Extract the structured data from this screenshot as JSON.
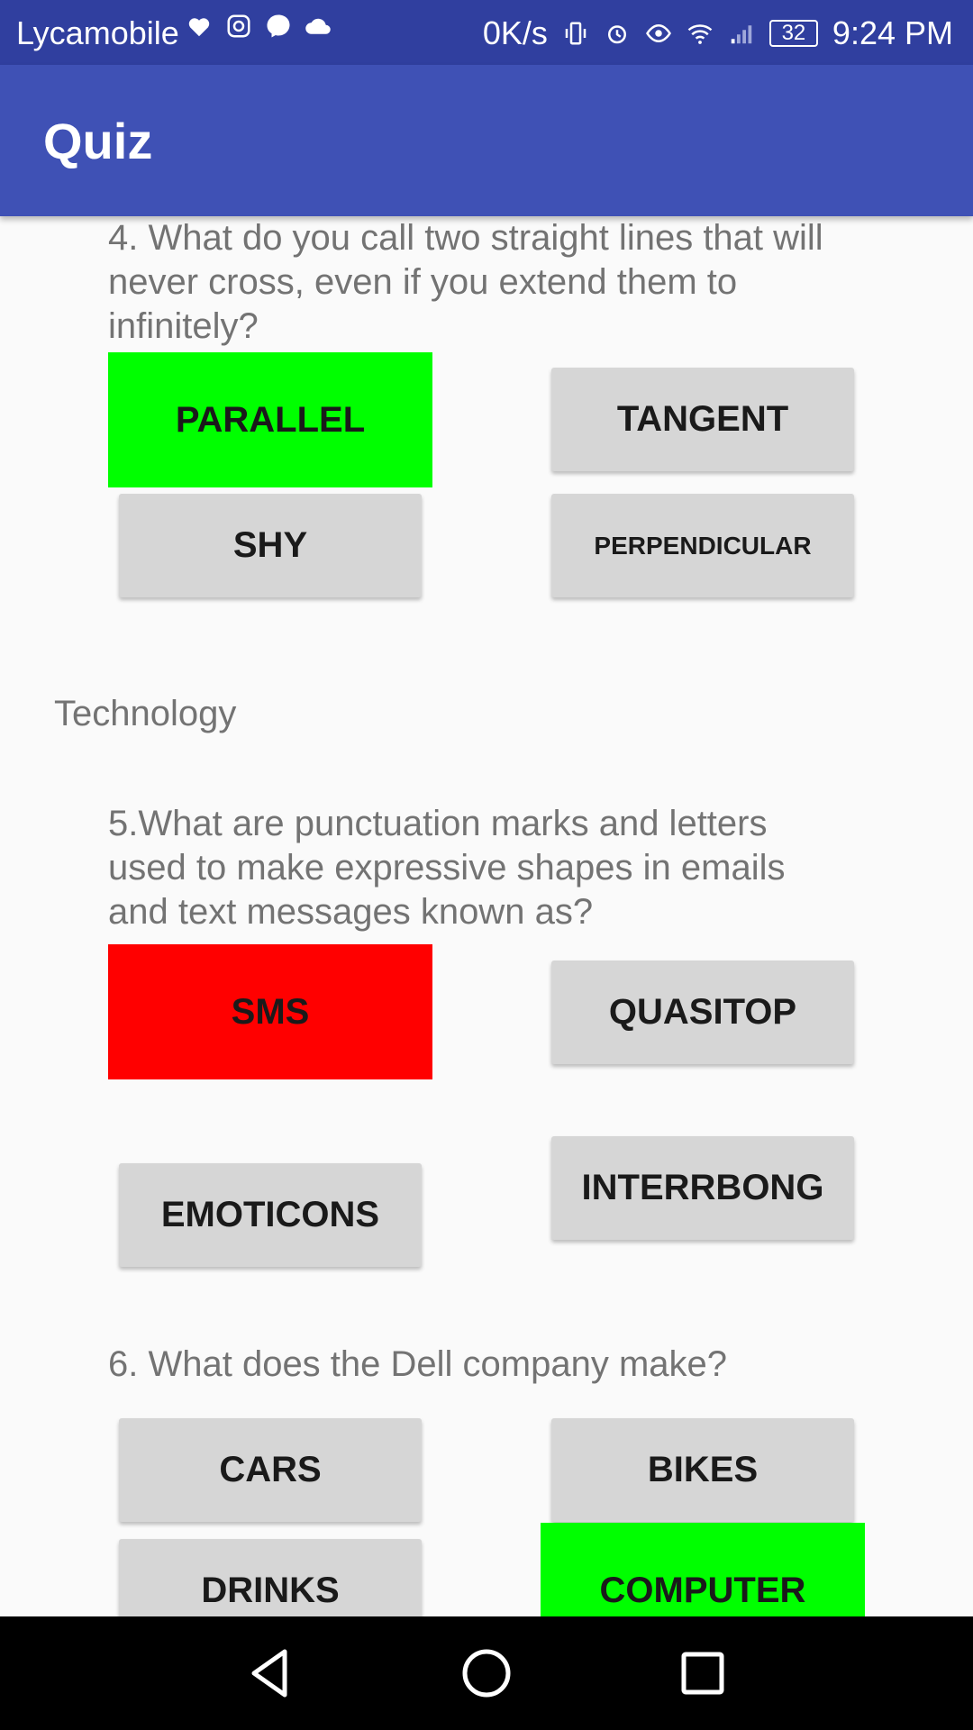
{
  "status_bar": {
    "carrier": "Lycamobile",
    "net_speed": "0K/s",
    "battery": "32",
    "time": "9:24 PM"
  },
  "app_bar": {
    "title": "Quiz"
  },
  "questions": {
    "q4": {
      "text": "4. What do you call two straight lines that will never cross, even if you extend them to infinitely?",
      "options": [
        "PARALLEL",
        "TANGENT",
        "SHY",
        "PERPENDICULAR"
      ]
    },
    "section_technology": "Technology",
    "q5": {
      "text": "5.What are punctuation marks and letters used to make expressive shapes in emails and text messages known as?",
      "options": [
        "SMS",
        "QUASITOP",
        "EMOTICONS",
        "INTERRBONG"
      ]
    },
    "q6": {
      "text": "6. What does the Dell company make?",
      "options": [
        "CARS",
        "BIKES",
        "DRINKS",
        "COMPUTER"
      ]
    }
  },
  "colors": {
    "status_bar": "#303f9f",
    "app_bar": "#3f51b5",
    "correct": "#00ff00",
    "wrong": "#ff0000",
    "button": "#d6d6d6"
  }
}
